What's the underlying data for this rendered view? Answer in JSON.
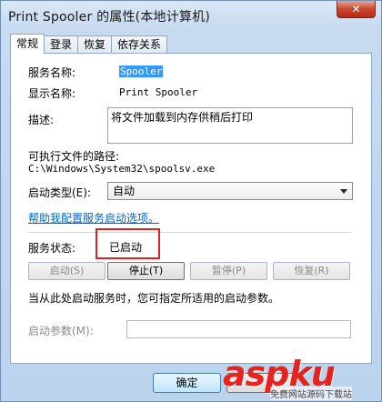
{
  "window": {
    "title": "Print Spooler 的属性(本地计算机)",
    "close_label": "✕"
  },
  "tabs": [
    {
      "label": "常规",
      "active": true
    },
    {
      "label": "登录",
      "active": false
    },
    {
      "label": "恢复",
      "active": false
    },
    {
      "label": "依存关系",
      "active": false
    }
  ],
  "general": {
    "service_name_label": "服务名称:",
    "service_name_value": "Spooler",
    "display_name_label": "显示名称:",
    "display_name_value": "Print Spooler",
    "description_label": "描述:",
    "description_value": "将文件加载到内存供稍后打印",
    "exe_path_label": "可执行文件的路径:",
    "exe_path_value": "C:\\Windows\\System32\\spoolsv.exe",
    "startup_type_label": "启动类型(E):",
    "startup_type_value": "自动",
    "help_link": "帮助我配置服务启动选项。",
    "service_status_label": "服务状态:",
    "service_status_value": "已启动",
    "buttons": {
      "start": "启动(S)",
      "stop": "停止(T)",
      "pause": "暂停(P)",
      "resume": "恢复(R)"
    },
    "hint": "当从此处启动服务时，您可指定所适用的启动参数。",
    "start_params_label": "启动参数(M):",
    "start_params_value": ""
  },
  "footer": {
    "ok_label": "确定"
  },
  "watermark": {
    "brand": "aspku",
    "tagline": "免费网站源码下载站"
  }
}
